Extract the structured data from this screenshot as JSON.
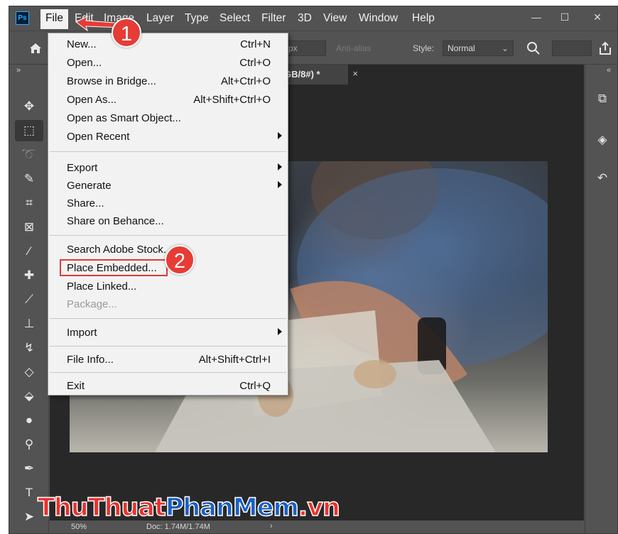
{
  "app": {
    "logo_text": "Ps"
  },
  "menubar": {
    "items": [
      "File",
      "Edit",
      "Image",
      "Layer",
      "Type",
      "Select",
      "Filter",
      "3D",
      "View",
      "Window",
      "Help"
    ],
    "window_controls": {
      "minimize": "—",
      "maximize": "☐",
      "close": "✕"
    }
  },
  "options": {
    "feather_value": "0 px",
    "antialias_label": "Anti-alias",
    "style_label": "Style:",
    "style_value": "Normal"
  },
  "document": {
    "tab_title": "GB/8#) *",
    "tab_close": "×"
  },
  "status": {
    "zoom": "50%",
    "doc_info": "Doc: 1.74M/1.74M",
    "arrow": "›"
  },
  "file_menu": {
    "items": [
      {
        "label": "New...",
        "shortcut": "Ctrl+N"
      },
      {
        "label": "Open...",
        "shortcut": "Ctrl+O"
      },
      {
        "label": "Browse in Bridge...",
        "shortcut": "Alt+Ctrl+O"
      },
      {
        "label": "Open As...",
        "shortcut": "Alt+Shift+Ctrl+O"
      },
      {
        "label": "Open as Smart Object...",
        "shortcut": ""
      },
      {
        "label": "Open Recent",
        "shortcut": "",
        "submenu": true
      },
      {
        "label": "Export",
        "shortcut": "",
        "submenu": true
      },
      {
        "label": "Generate",
        "shortcut": "",
        "submenu": true
      },
      {
        "label": "Share...",
        "shortcut": ""
      },
      {
        "label": "Share on Behance...",
        "shortcut": ""
      },
      {
        "label": "Search Adobe Stock...",
        "shortcut": ""
      },
      {
        "label": "Place Embedded...",
        "shortcut": ""
      },
      {
        "label": "Place Linked...",
        "shortcut": ""
      },
      {
        "label": "Package...",
        "shortcut": "",
        "disabled": true
      },
      {
        "label": "Import",
        "shortcut": "",
        "submenu": true
      },
      {
        "label": "File Info...",
        "shortcut": "Alt+Shift+Ctrl+I"
      },
      {
        "label": "Exit",
        "shortcut": "Ctrl+Q"
      }
    ]
  },
  "annotations": {
    "step1": "1",
    "step2": "2",
    "highlight_color": "#e03a35"
  },
  "watermark": {
    "part1": "ThuThuat",
    "part2": "PhanMem",
    "part3": ".vn"
  },
  "colors": {
    "ui_bg": "#535353",
    "canvas_bg": "#282828",
    "menu_bg": "#f2f2f2",
    "accent_red": "#e63c36"
  }
}
